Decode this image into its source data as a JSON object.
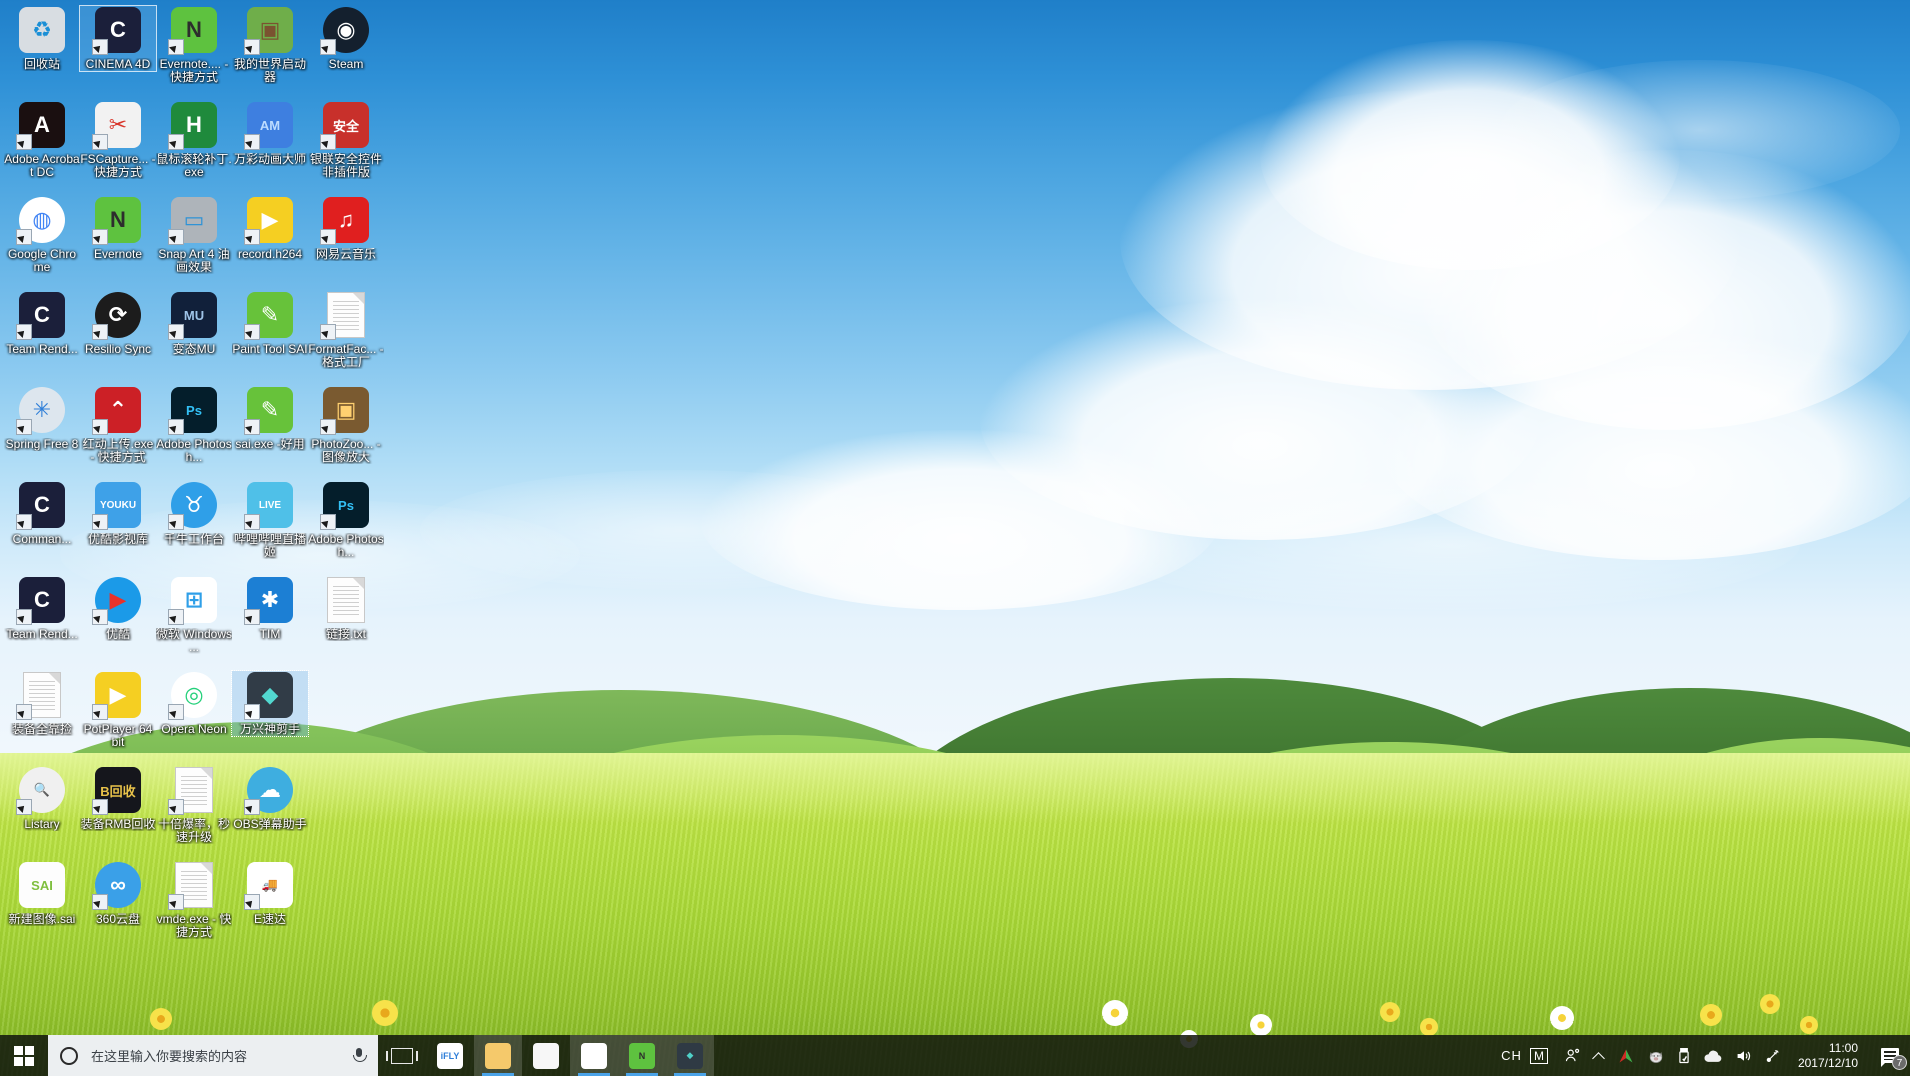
{
  "desktop": {
    "wallpaper_description": "green grassland hills with blue sky and white clouds",
    "colors": {
      "sky_top": "#1f7fc9",
      "sky_bottom": "#f2f8fd",
      "grass_bright": "#c9e84f",
      "hill_green": "#6fae4a",
      "taskbar": "#12160e",
      "search_bg": "#eceff1",
      "accent": "#4aa3e8"
    },
    "icons": [
      {
        "label": "回收站",
        "icon": "recycle-bin-icon",
        "shortcut": false,
        "selected": false,
        "col": 0,
        "row": 0,
        "bg": "#d8dde2",
        "fg": "#1b8fd6",
        "text": "♻"
      },
      {
        "label": "CINEMA 4D",
        "icon": "cinema-4d-icon",
        "shortcut": true,
        "selected": false,
        "focus": true,
        "col": 1,
        "row": 0,
        "bg": "#1b1f3a",
        "fg": "#ffffff",
        "text": "C"
      },
      {
        "label": "Evernote.... - 快捷方式",
        "icon": "evernote-icon",
        "shortcut": true,
        "selected": false,
        "col": 2,
        "row": 0,
        "bg": "#5ec23f",
        "fg": "#2d2d2d",
        "text": "N"
      },
      {
        "label": "我的世界启动器",
        "icon": "minecraft-launcher-icon",
        "shortcut": true,
        "selected": false,
        "col": 3,
        "row": 0,
        "bg": "#6fae4a",
        "fg": "#7a5230",
        "text": "▣"
      },
      {
        "label": "Steam",
        "icon": "steam-icon",
        "shortcut": true,
        "selected": false,
        "col": 4,
        "row": 0,
        "bg": "#14202e",
        "fg": "#ffffff",
        "text": "◉"
      },
      {
        "label": "Adobe Acrobat DC",
        "icon": "adobe-acrobat-icon",
        "shortcut": true,
        "selected": false,
        "col": 0,
        "row": 1,
        "bg": "#1a0f10",
        "fg": "#ffffff",
        "text": "A"
      },
      {
        "label": "FSCapture... - 快捷方式",
        "icon": "fscapture-icon",
        "shortcut": true,
        "selected": false,
        "col": 1,
        "row": 1,
        "bg": "#f2f2f2",
        "fg": "#d8352a",
        "text": "✂"
      },
      {
        "label": "鼠标滚轮补丁.exe",
        "icon": "mouse-wheel-patch-icon",
        "shortcut": true,
        "selected": false,
        "col": 2,
        "row": 1,
        "bg": "#1f8a3c",
        "fg": "#ffffff",
        "text": "H"
      },
      {
        "label": "万彩动画大师",
        "icon": "animation-master-icon",
        "shortcut": true,
        "selected": false,
        "col": 3,
        "row": 1,
        "bg": "#3e7fe0",
        "fg": "#bcdcff",
        "text": "AM"
      },
      {
        "label": "银联安全控件 非插件版",
        "icon": "unionpay-security-shield-icon",
        "shortcut": true,
        "selected": false,
        "col": 4,
        "row": 1,
        "bg": "#c8302b",
        "fg": "#ffffff",
        "text": "安全"
      },
      {
        "label": "Google Chrome",
        "icon": "google-chrome-icon",
        "shortcut": true,
        "selected": false,
        "col": 0,
        "row": 2,
        "bg": "#ffffff",
        "fg": "#4285f4",
        "text": "◍"
      },
      {
        "label": "Evernote",
        "icon": "evernote-icon",
        "shortcut": true,
        "selected": false,
        "col": 1,
        "row": 2,
        "bg": "#5ec23f",
        "fg": "#2d2d2d",
        "text": "N"
      },
      {
        "label": "Snap Art 4 油画效果",
        "icon": "snap-art-icon",
        "shortcut": true,
        "selected": false,
        "col": 2,
        "row": 2,
        "bg": "#aeb4ba",
        "fg": "#2f93d6",
        "text": "▭"
      },
      {
        "label": "record.h264",
        "icon": "potplayer-file-icon",
        "shortcut": true,
        "selected": false,
        "col": 3,
        "row": 2,
        "bg": "#f5cf22",
        "fg": "#ffffff",
        "text": "▶"
      },
      {
        "label": "网易云音乐",
        "icon": "netease-music-icon",
        "shortcut": true,
        "selected": false,
        "col": 4,
        "row": 2,
        "bg": "#e01f1f",
        "fg": "#ffffff",
        "text": "♫"
      },
      {
        "label": "Team Rend...",
        "icon": "cinema-4d-team-render-icon",
        "shortcut": true,
        "selected": false,
        "col": 0,
        "row": 3,
        "bg": "#1b1f3a",
        "fg": "#ffffff",
        "text": "C"
      },
      {
        "label": "Resilio Sync",
        "icon": "resilio-sync-icon",
        "shortcut": true,
        "selected": false,
        "col": 1,
        "row": 3,
        "bg": "#1c1c1c",
        "fg": "#ffffff",
        "text": "⟳"
      },
      {
        "label": "变态MU",
        "icon": "mu-game-icon",
        "shortcut": true,
        "selected": false,
        "col": 2,
        "row": 3,
        "bg": "#11203a",
        "fg": "#9fc4e8",
        "text": "MU"
      },
      {
        "label": "Paint Tool SAI",
        "icon": "paint-tool-sai-icon",
        "shortcut": true,
        "selected": false,
        "col": 3,
        "row": 3,
        "bg": "#67c23a",
        "fg": "#ffffff",
        "text": "✎"
      },
      {
        "label": "FormatFac... - 格式工厂",
        "icon": "format-factory-icon",
        "shortcut": true,
        "selected": false,
        "col": 4,
        "row": 3,
        "bg": "#fdfdfd",
        "fg": "#888888",
        "text": ""
      },
      {
        "label": "Spring Free 8",
        "icon": "spring-free-icon",
        "shortcut": true,
        "selected": false,
        "col": 0,
        "row": 4,
        "bg": "#dde6ee",
        "fg": "#2f7fd8",
        "text": "✳"
      },
      {
        "label": "红动上传.exe - 快捷方式",
        "icon": "hongdong-upload-icon",
        "shortcut": true,
        "selected": false,
        "col": 1,
        "row": 4,
        "bg": "#cc2026",
        "fg": "#ffffff",
        "text": "⌃"
      },
      {
        "label": "Adobe Photosh...",
        "icon": "adobe-photoshop-icon",
        "shortcut": true,
        "selected": false,
        "col": 2,
        "row": 4,
        "bg": "#041e2b",
        "fg": "#33c0f5",
        "text": "Ps"
      },
      {
        "label": "sai.exe -好用",
        "icon": "paint-tool-sai-icon",
        "shortcut": true,
        "selected": false,
        "col": 3,
        "row": 4,
        "bg": "#67c23a",
        "fg": "#ffffff",
        "text": "✎"
      },
      {
        "label": "PhotoZoo... -图像放大",
        "icon": "photozoom-icon",
        "shortcut": true,
        "selected": false,
        "col": 4,
        "row": 4,
        "bg": "#7a5a30",
        "fg": "#ffd070",
        "text": "▣"
      },
      {
        "label": "Comman...",
        "icon": "cinema-4d-commandline-icon",
        "shortcut": true,
        "selected": false,
        "col": 0,
        "row": 5,
        "bg": "#1b1f3a",
        "fg": "#ffffff",
        "text": "C"
      },
      {
        "label": "优酷影视库",
        "icon": "youku-folder-icon",
        "shortcut": true,
        "selected": false,
        "col": 1,
        "row": 5,
        "bg": "#3ea1e8",
        "fg": "#ffffff",
        "text": "YOUKU"
      },
      {
        "label": "千牛工作台",
        "icon": "qianniu-icon",
        "shortcut": true,
        "selected": false,
        "col": 2,
        "row": 5,
        "bg": "#2f9fe8",
        "fg": "#ffffff",
        "text": "♉"
      },
      {
        "label": "哔哩哔哩直播姬",
        "icon": "bilibili-live-icon",
        "shortcut": true,
        "selected": false,
        "col": 3,
        "row": 5,
        "bg": "#4fc0e8",
        "fg": "#ffffff",
        "text": "LIVE"
      },
      {
        "label": "Adobe Photosh...",
        "icon": "adobe-photoshop-icon",
        "shortcut": true,
        "selected": false,
        "col": 4,
        "row": 5,
        "bg": "#041e2b",
        "fg": "#33c0f5",
        "text": "Ps"
      },
      {
        "label": "Team Rend...",
        "icon": "cinema-4d-team-render-icon",
        "shortcut": true,
        "selected": false,
        "col": 0,
        "row": 6,
        "bg": "#1b1f3a",
        "fg": "#ffffff",
        "text": "C"
      },
      {
        "label": "优酷",
        "icon": "youku-icon",
        "shortcut": true,
        "selected": false,
        "col": 1,
        "row": 6,
        "bg": "#1b9ae8",
        "fg": "#e8322a",
        "text": "▶"
      },
      {
        "label": "微软 Windows ...",
        "icon": "microsoft-windows-defender-icon",
        "shortcut": true,
        "selected": false,
        "col": 2,
        "row": 6,
        "bg": "#ffffff",
        "fg": "#2f9fe8",
        "text": "⊞"
      },
      {
        "label": "TIM",
        "icon": "tim-icon",
        "shortcut": true,
        "selected": false,
        "col": 3,
        "row": 6,
        "bg": "#1c7fd4",
        "fg": "#ffffff",
        "text": "✱"
      },
      {
        "label": "链接.txt",
        "icon": "text-file-icon",
        "shortcut": false,
        "selected": false,
        "col": 4,
        "row": 6,
        "bg": "#fdfdfd",
        "fg": "#999999",
        "text": ""
      },
      {
        "label": "装备全靠捡",
        "icon": "blank-document-icon",
        "shortcut": true,
        "selected": false,
        "col": 0,
        "row": 7,
        "bg": "#fdfdfd",
        "fg": "#999999",
        "text": ""
      },
      {
        "label": "PotPlayer 64 bit",
        "icon": "potplayer-icon",
        "shortcut": true,
        "selected": false,
        "col": 1,
        "row": 7,
        "bg": "#f5cf22",
        "fg": "#ffffff",
        "text": "▶"
      },
      {
        "label": "Opera Neon",
        "icon": "opera-neon-icon",
        "shortcut": true,
        "selected": false,
        "col": 2,
        "row": 7,
        "bg": "#ffffff",
        "fg": "#24d07a",
        "text": "◎"
      },
      {
        "label": "万兴神剪手",
        "icon": "wondershare-filmora-icon",
        "shortcut": true,
        "selected": true,
        "col": 3,
        "row": 7,
        "bg": "#2f3a44",
        "fg": "#4fd0c8",
        "text": "◆"
      },
      {
        "label": "Listary",
        "icon": "listary-icon",
        "shortcut": true,
        "selected": false,
        "col": 0,
        "row": 8,
        "bg": "#f0f0f0",
        "fg": "#c0392b",
        "text": "🔍"
      },
      {
        "label": "装备RMB回收",
        "icon": "game-rmb-recycle-icon",
        "shortcut": true,
        "selected": false,
        "col": 1,
        "row": 8,
        "bg": "#15161c",
        "fg": "#e8c24a",
        "text": "B回收"
      },
      {
        "label": "十倍爆率，秒速升级",
        "icon": "blank-document-icon",
        "shortcut": true,
        "selected": false,
        "col": 2,
        "row": 8,
        "bg": "#fdfdfd",
        "fg": "#999999",
        "text": ""
      },
      {
        "label": "OBS弹幕助手",
        "icon": "obs-danmaku-icon",
        "shortcut": true,
        "selected": false,
        "col": 3,
        "row": 8,
        "bg": "#3eaee0",
        "fg": "#ffffff",
        "text": "☁"
      },
      {
        "label": "新建图像.sai",
        "icon": "sai-image-file-icon",
        "shortcut": false,
        "selected": false,
        "col": 0,
        "row": 9,
        "bg": "#fdfdfd",
        "fg": "#7fbf3f",
        "text": "SAI"
      },
      {
        "label": "360云盘",
        "icon": "360-cloud-icon",
        "shortcut": true,
        "selected": false,
        "col": 1,
        "row": 9,
        "bg": "#3aa0e8",
        "fg": "#ffffff",
        "text": "∞"
      },
      {
        "label": "vmde.exe - 快捷方式",
        "icon": "blank-document-icon",
        "shortcut": true,
        "selected": false,
        "col": 2,
        "row": 9,
        "bg": "#fdfdfd",
        "fg": "#999999",
        "text": ""
      },
      {
        "label": "E速达",
        "icon": "esuda-truck-icon",
        "shortcut": true,
        "selected": false,
        "col": 3,
        "row": 9,
        "bg": "#ffffff",
        "fg": "#6fbf4a",
        "text": "🚚"
      }
    ]
  },
  "taskbar": {
    "start_label": "开始",
    "start_icon": "windows-logo-icon",
    "search": {
      "placeholder": "在这里输入你要搜索的内容",
      "cortana_icon": "cortana-circle-icon",
      "mic_icon": "microphone-icon"
    },
    "task_view": {
      "label": "任务视图",
      "icon": "task-view-icon"
    },
    "pinned_apps": [
      {
        "label": "讯飞输入法",
        "icon": "iflytek-icon",
        "text": "iFLY",
        "bg": "#ffffff",
        "fg": "#2f7fd8",
        "running": false
      },
      {
        "label": "文件资源管理器",
        "icon": "file-explorer-icon",
        "text": "",
        "bg": "#f5c96b",
        "fg": "#ffffff",
        "running": true
      },
      {
        "label": "FastStone Capture",
        "icon": "fscapture-icon",
        "text": "",
        "bg": "#f7f7f7",
        "fg": "#d8352a",
        "running": false
      },
      {
        "label": "Google Chrome",
        "icon": "google-chrome-icon",
        "text": "",
        "bg": "#ffffff",
        "fg": "#4285f4",
        "running": true
      },
      {
        "label": "Evernote",
        "icon": "evernote-icon",
        "text": "N",
        "bg": "#5ec23f",
        "fg": "#2d2d2d",
        "running": true
      },
      {
        "label": "万兴神剪手",
        "icon": "wondershare-filmora-icon",
        "text": "◆",
        "bg": "#2f3a44",
        "fg": "#4fd0c8",
        "running": true
      }
    ],
    "tray": {
      "ime": {
        "language": "CH",
        "mode": "M",
        "icon": "input-method-icon"
      },
      "icons": [
        {
          "name": "people-icon",
          "glyph": ""
        },
        {
          "name": "show-hidden-icons-chevron-icon",
          "glyph": ""
        },
        {
          "name": "kingsoft-antivirus-icon",
          "glyph": ""
        },
        {
          "name": "pig-mascot-icon",
          "glyph": ""
        },
        {
          "name": "safely-remove-usb-icon",
          "glyph": ""
        },
        {
          "name": "onedrive-cloud-icon",
          "glyph": ""
        },
        {
          "name": "volume-speaker-icon",
          "glyph": ""
        },
        {
          "name": "network-icon",
          "glyph": ""
        }
      ],
      "clock": {
        "time": "11:00",
        "date": "2017/12/10"
      },
      "action_center": {
        "icon": "action-center-icon",
        "badge": "7"
      }
    }
  }
}
